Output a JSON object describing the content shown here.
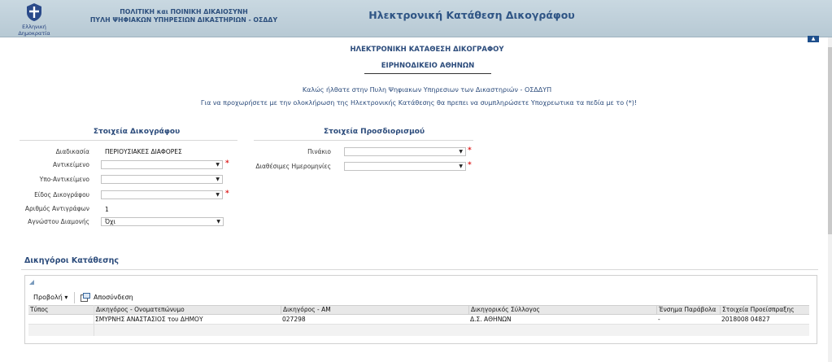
{
  "header": {
    "emblem_text": "Ελληνική Δημοκρατία",
    "org_line1": "ΠΟΛΙΤΙΚΗ και ΠΟΙΝΙΚΗ ΔΙΚΑΙΟΣΥΝΗ",
    "org_line2": "ΠΥΛΗ ΨΗΦΙΑΚΩΝ ΥΠΗΡΕΣΙΩΝ ΔΙΚΑΣΤΗΡΙΩΝ - ΟΣΔΔΥ",
    "app_title": "Ηλεκτρονική Κατάθεση Δικογράφου"
  },
  "page": {
    "title": "ΗΛΕΚΤΡΟΝΙΚΗ ΚΑΤΑΘΕΣΗ ΔΙΚΟΓΡΑΦΟΥ",
    "court": "ΕΙΡΗΝΟΔΙΚΕΙΟ ΑΘΗΝΩΝ",
    "welcome": "Καλώς ήλθατε στην Πυλη Ψηφιακων Υπηρεσιων των Δικαστηριών - ΟΣΔΔΥΠ",
    "instructions": "Για να προχωρήσετε με την ολοκλήρωση της Ηλεκτρονικής Κατάθεσης θα πρεπει να συμπληρώσετε Υποχρεωτικα τα πεδία με το (*)!"
  },
  "doc_section": {
    "title": "Στοιχεία Δικογράφου",
    "fields": {
      "procedure": {
        "label": "Διαδικασία",
        "value": "ΠΕΡΙΟΥΣΙΑΚΕΣ ΔΙΑΦΟΡΕΣ"
      },
      "subject": {
        "label": "Αντικείμενο",
        "value": ""
      },
      "subsubject": {
        "label": "Υπο-Αντικείμενο",
        "value": ""
      },
      "doc_type": {
        "label": "Είδος Δικογράφου",
        "value": ""
      },
      "copies": {
        "label": "Αριθμός Αντιγράφων",
        "value": "1"
      },
      "unknown_residence": {
        "label": "Αγνώστου Διαμονής",
        "value": "Όχι"
      }
    }
  },
  "schedule_section": {
    "title": "Στοιχεία Προσδιορισμού",
    "fields": {
      "docket": {
        "label": "Πινάκιο",
        "value": ""
      },
      "dates": {
        "label": "Διαθέσιμες Ημερομηνίες",
        "value": ""
      }
    }
  },
  "required_mark": "*",
  "lawyers": {
    "title": "Δικηγόροι Κατάθεσης",
    "toolbar": {
      "view_label": "Προβολή ▾",
      "detach_label": "Αποσύνδεση"
    },
    "columns": [
      "Τύπος",
      "Δικηγόρος - Ονοματεπώνυμο",
      "Δικηγόρος - ΑΜ",
      "Δικηγορικός Σύλλογος",
      "Ένσημα Παράβολα",
      "Στοιχεία Προείσπραξης"
    ],
    "rows": [
      [
        "",
        "ΣΜΥΡΝΗΣ ΑΝΑΣΤΑΣΙΟΣ του ΔΗΜΟΥ",
        "027298",
        "Δ.Σ. ΑΘΗΝΩΝ",
        "-",
        "2018008 04827"
      ]
    ]
  },
  "colors": {
    "accent": "#2b4b7b",
    "header_bg": "#c4d4de",
    "required": "#dd2222"
  }
}
